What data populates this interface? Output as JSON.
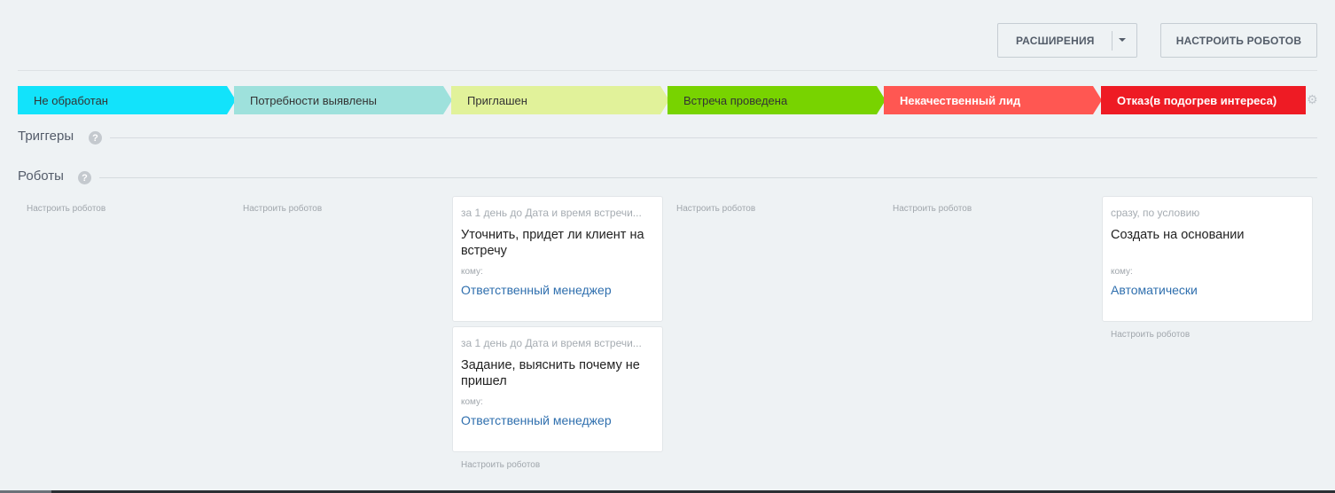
{
  "toolbar": {
    "extensions_label": "РАСШИРЕНИЯ",
    "configure_robots_label": "НАСТРОИТЬ РОБОТОВ"
  },
  "stages": [
    {
      "label": "Не обработан",
      "color": "#12e3fb"
    },
    {
      "label": "Потребности выявлены",
      "color": "#9ee1dc"
    },
    {
      "label": "Приглашен",
      "color": "#e1f29a"
    },
    {
      "label": "Встреча проведена",
      "color": "#78d300"
    },
    {
      "label": "Некачественный лид",
      "color": "#ff5752"
    },
    {
      "label": "Отказ(в подогрев интереса)",
      "color": "#ee1b24"
    }
  ],
  "sections": {
    "triggers": "Триггеры",
    "robots": "Роботы"
  },
  "columns": {
    "configure_label": "Настроить роботов",
    "c3": {
      "cards": [
        {
          "when": "за 1 день до Дата и время встречи...",
          "name": "Уточнить, придет ли клиент на встречу",
          "to_label": "кому:",
          "to": "Ответственный менеджер"
        },
        {
          "when": "за 1 день до Дата и время встречи...",
          "name": "Задание, выяснить почему не пришел",
          "to_label": "кому:",
          "to": "Ответственный менеджер"
        }
      ]
    },
    "c6": {
      "cards": [
        {
          "when": "сразу, по условию",
          "name": "Создать на основании",
          "to_label": "кому:",
          "to": "Автоматически"
        }
      ]
    }
  }
}
